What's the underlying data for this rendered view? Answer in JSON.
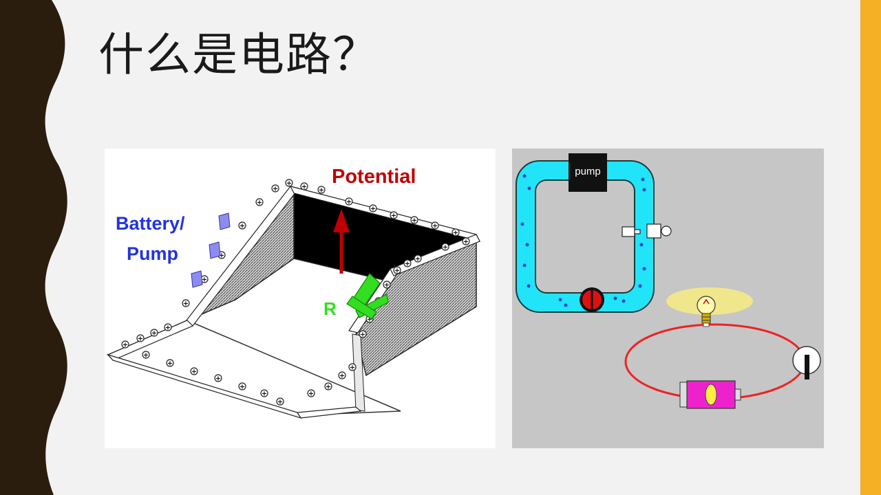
{
  "slide": {
    "title": "什么是电路？",
    "colors": {
      "background": "#f2f2f2",
      "left_band": "#2b1d0e",
      "right_band": "#f5b025"
    }
  },
  "left_figure": {
    "potential_label": "Potential",
    "battery_label_line1": "Battery/",
    "battery_label_line2": "Pump",
    "resistor_label": "R",
    "charge_symbol": "+"
  },
  "right_figure": {
    "pump_label": "pump"
  }
}
